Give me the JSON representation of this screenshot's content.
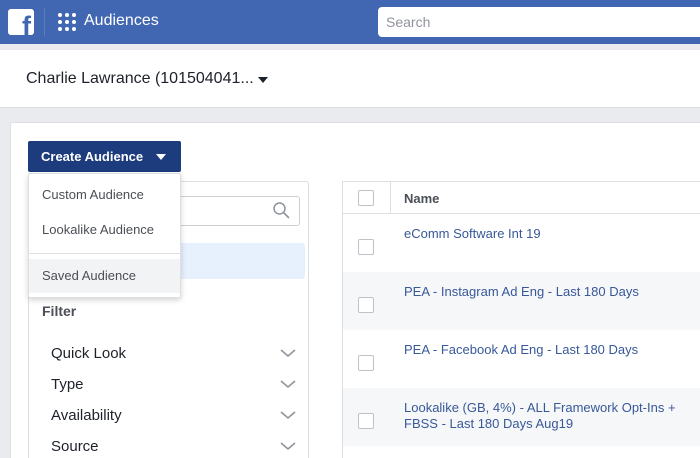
{
  "header": {
    "logo_letter": "f",
    "app_title": "Audiences",
    "search_placeholder": "Search",
    "color": "#4267b2"
  },
  "account": {
    "name": "Charlie Lawrance (101504041..."
  },
  "create_button": {
    "label": "Create Audience",
    "color": "#1d3c7d"
  },
  "create_menu": {
    "items": [
      "Custom Audience",
      "Lookalike Audience",
      "Saved Audience"
    ]
  },
  "filters": {
    "title": "Filter",
    "items": [
      "Quick Look",
      "Type",
      "Availability",
      "Source"
    ]
  },
  "table": {
    "columns": [
      "Name"
    ],
    "rows": [
      {
        "name": "eComm Software Int 19"
      },
      {
        "name": "PEA - Instagram Ad Eng - Last 180 Days"
      },
      {
        "name": "PEA - Facebook Ad Eng - Last 180 Days"
      },
      {
        "name": "Lookalike (GB, 4%) - ALL Framework Opt-Ins + FBSS - Last 180 Days Aug19"
      }
    ],
    "link_color": "#385898"
  }
}
